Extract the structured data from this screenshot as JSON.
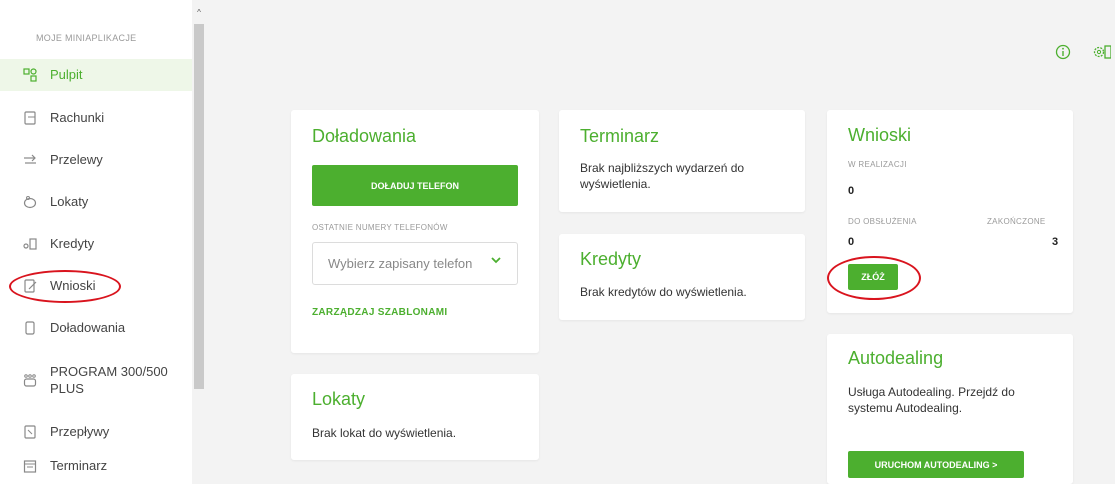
{
  "sidebar": {
    "header": "MOJE MINIAPLIKACJE",
    "items": [
      {
        "label": "Pulpit",
        "icon": "dashboard-icon"
      },
      {
        "label": "Rachunki",
        "icon": "accounts-icon"
      },
      {
        "label": "Przelewy",
        "icon": "transfers-icon"
      },
      {
        "label": "Lokaty",
        "icon": "deposits-icon"
      },
      {
        "label": "Kredyty",
        "icon": "credits-icon"
      },
      {
        "label": "Wnioski",
        "icon": "applications-icon"
      },
      {
        "label": "Doładowania",
        "icon": "phone-topup-icon"
      },
      {
        "label": "PROGRAM 300/500 PLUS",
        "icon": "family-program-icon"
      },
      {
        "label": "Przepływy",
        "icon": "cashflow-icon"
      },
      {
        "label": "Terminarz",
        "icon": "calendar-icon"
      }
    ],
    "active_item": "Pulpit",
    "scroll_up": "^"
  },
  "topbar": {
    "info_icon": "info-icon",
    "settings_icon": "settings-icon"
  },
  "cards": {
    "doladowania": {
      "title": "Doładowania",
      "button": "DOŁADUJ TELEFON",
      "recent_label": "OSTATNIE NUMERY TELEFONÓW",
      "select_placeholder": "Wybierz zapisany telefon",
      "manage_link": "ZARZĄDZAJ SZABLONAMI"
    },
    "terminarz": {
      "title": "Terminarz",
      "text": "Brak najbliższych wydarzeń do wyświetlenia."
    },
    "kredyty": {
      "title": "Kredyty",
      "text": "Brak kredytów do wyświetlenia."
    },
    "wnioski": {
      "title": "Wnioski",
      "in_progress_label": "W REALIZACJI",
      "in_progress_value": "0",
      "to_handle_label": "DO OBSŁUŻENIA",
      "to_handle_value": "0",
      "completed_label": "ZAKOŃCZONE",
      "completed_value": "3",
      "button": "ZŁÓŻ"
    },
    "lokaty": {
      "title": "Lokaty",
      "text": "Brak lokat do wyświetlenia."
    },
    "autodealing": {
      "title": "Autodealing",
      "text": "Usługa Autodealing. Przejdź do systemu Autodealing.",
      "button": "URUCHOM AUTODEALING >"
    }
  },
  "colors": {
    "accent": "#4caf2f",
    "annotation": "#d9141e",
    "background": "#f3f3f3"
  }
}
